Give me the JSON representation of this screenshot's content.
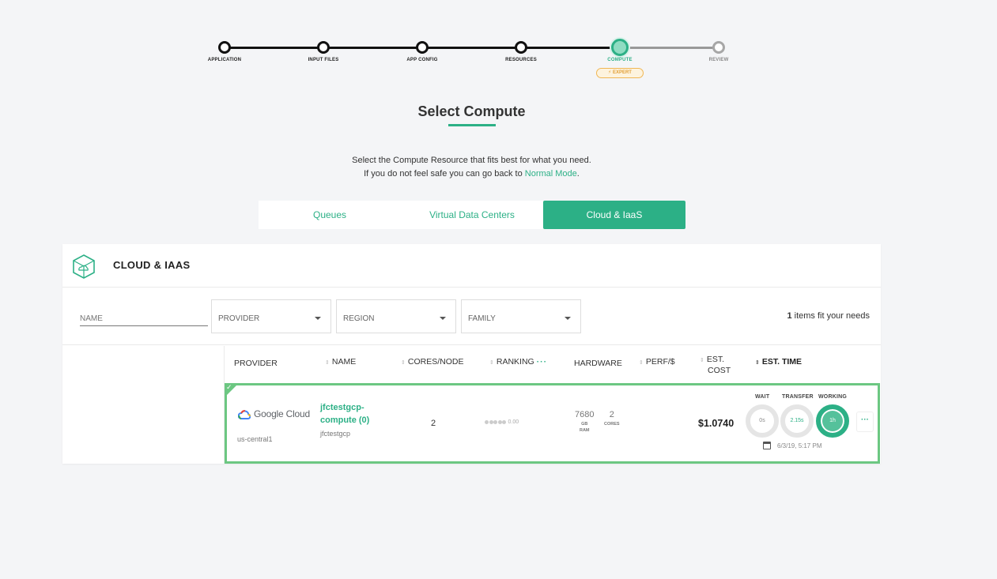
{
  "stepper": {
    "steps": [
      {
        "label": "APPLICATION"
      },
      {
        "label": "INPUT FILES"
      },
      {
        "label": "APP CONFIG"
      },
      {
        "label": "RESOURCES"
      },
      {
        "label": "COMPUTE"
      },
      {
        "label": "REVIEW"
      }
    ],
    "badge": "EXPERT"
  },
  "page": {
    "title": "Select Compute",
    "subtitle_line1": "Select the Compute Resource that fits best for what you need.",
    "subtitle_line2_prefix": "If you do not feel safe you can go back to ",
    "subtitle_link": "Normal Mode",
    "subtitle_line2_suffix": "."
  },
  "tabs": [
    {
      "label": "Queues",
      "active": false
    },
    {
      "label": "Virtual Data Centers",
      "active": false
    },
    {
      "label": "Cloud & IaaS",
      "active": true
    }
  ],
  "card": {
    "title": "CLOUD & IAAS",
    "filters": {
      "name_placeholder": "NAME",
      "provider": "PROVIDER",
      "region": "REGION",
      "family": "FAMILY",
      "count": "1",
      "count_suffix": " items fit your needs"
    },
    "columns": {
      "provider": "PROVIDER",
      "name": "NAME",
      "cores": "CORES/NODE",
      "ranking": "RANKING",
      "ranking_more": "···",
      "hardware": "HARDWARE",
      "perf": "PERF/$",
      "est_cost_1": "EST.",
      "est_cost_2": "COST",
      "est_time": "EST. TIME"
    },
    "row": {
      "provider_name": "Google Cloud",
      "region": "us-central1",
      "name": "jfctestgcp-compute (0)",
      "subname": "jfctestgcp",
      "cores_per_node": "2",
      "ranking": "0.00",
      "ram_value": "7680",
      "ram_unit_1": "GB",
      "ram_unit_2": "RAM",
      "cores_value": "2",
      "cores_unit": "CORES",
      "price": "$1.0740",
      "wait_label": "WAIT",
      "wait_value": "0s",
      "transfer_label": "TRANSFER",
      "transfer_value": "2.15s",
      "working_label": "WORKING",
      "working_value": "1h",
      "more": "···",
      "date": "6/3/19, 5:17 PM"
    }
  },
  "colors": {
    "accent": "#2cb086",
    "selected_border": "#6cc782",
    "expert": "#e2a13a"
  }
}
